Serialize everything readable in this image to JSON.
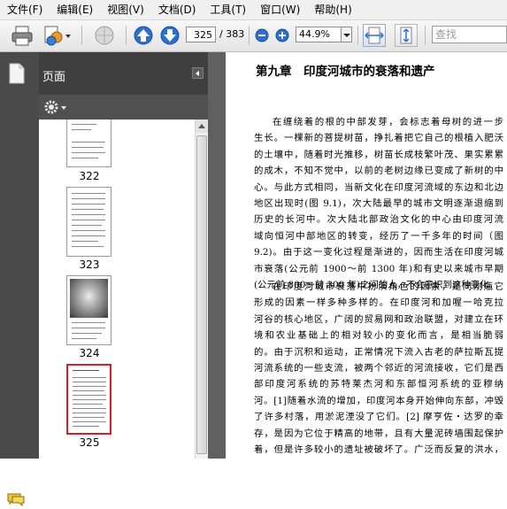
{
  "menu": [
    "文件(F)",
    "编辑(E)",
    "视图(V)",
    "文档(D)",
    "工具(T)",
    "窗口(W)",
    "帮助(H)"
  ],
  "toolbar": {
    "current_page": "325",
    "total_pages": "/ 383",
    "zoom": "44.9%",
    "search_placeholder": "查找"
  },
  "sidebar": {
    "title": "页面",
    "thumbnails": [
      {
        "label": "322",
        "selected": false
      },
      {
        "label": "323",
        "selected": false
      },
      {
        "label": "324",
        "selected": false
      },
      {
        "label": "325",
        "selected": true
      }
    ]
  },
  "document": {
    "chapter_title": "第九章　印度河城市的衰落和遗产",
    "paragraph1": [
      "在缠绕着的根的中部发芽，会标志着母树的进一步",
      "生长。一棵新的菩提树苗，挣扎着把它自己的根植入肥沃",
      "的土壤中，随着时光推移，树苗长成枝繁叶茂、果实累累",
      "的成木，不知不觉中，以前的老树边缘已变成了新树的中",
      "心。与此方式相同，当新文化在印度河流域的东边和北边",
      "地区出现时(图 9.1)，次大陆最早的城市文明逐渐退缩到",
      "历史的长河中。次大陆北部政治文化的中心由印度河流",
      "域向恒河中部地区的转变，经历了一千多年的时间（图",
      "9.2)。由于这一变化过程是渐进的，因而生活在印度河城",
      "市衰落(公元前 1900～前 1300 年)和有史以来城市早期",
      "(公元前 800～前 300 年)之间的人，不会意识到这种变化。"
    ],
    "paragraph2": [
      "在印度河城市衰落中扮演角色的因素，是同刚瓶它",
      "形成的因素一样多种多样的。在印度河和加喔一哈克拉",
      "河谷的核心地区，广阔的贸易网和政治联盟，对建立在环",
      "境和农业基础上的相对较小的变化而言，是相当脆弱",
      "的。由于沉积和运动，正常情况下流入古老的萨拉斯瓦提",
      "河流系统的一些支流，被两个邻近的河流接收，它们是西",
      "部印度河系统的苏特莱杰河和东部恒河系统的亚穆纳",
      "河。[1]随着水流的增加，印度河本身开始伸向东部，冲毁",
      "了许多村落，用淤泥湮没了它们。[2] 摩亨佐・达罗的幸",
      "存，是因为它位于精高的地带，且有大量泥砖墙围起保护",
      "着，但是许多较小的遗址被破坏了。广泛而反复的洪水，",
      "结合着变向的河流，对印度河城市的农业基础和经济结"
    ]
  },
  "colors": {
    "selection_border": "#d42020",
    "nav_dark": "#3f3f3f",
    "toolbar_accent": "#2b6fd0"
  }
}
